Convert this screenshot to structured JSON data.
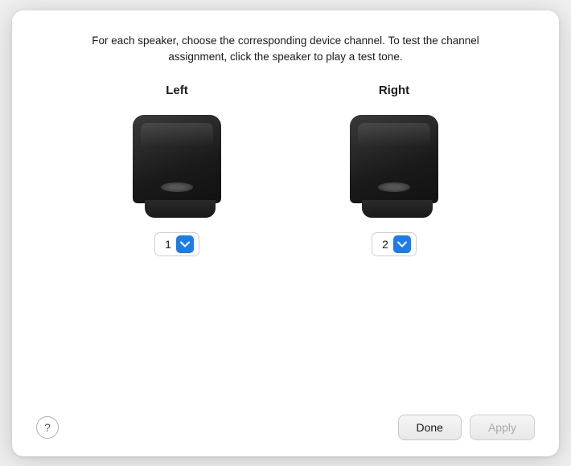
{
  "dialog": {
    "description": "For each speaker, choose the corresponding device channel. To test the channel assignment, click the speaker to play a test tone.",
    "speakers": [
      {
        "id": "left",
        "label": "Left",
        "channel_value": "1"
      },
      {
        "id": "right",
        "label": "Right",
        "channel_value": "2"
      }
    ],
    "footer": {
      "help_symbol": "?",
      "done_label": "Done",
      "apply_label": "Apply"
    }
  }
}
